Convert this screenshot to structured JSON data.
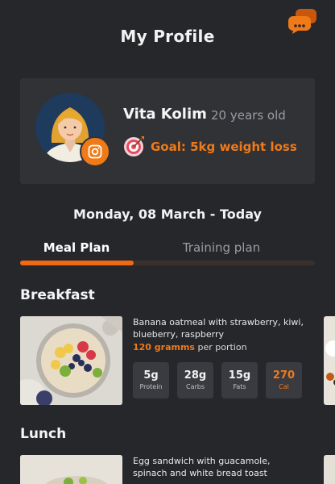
{
  "header": {
    "title": "My Profile"
  },
  "profile": {
    "name": "Vita Kolim",
    "age": "20 years old",
    "goal": "Goal: 5kg weight loss"
  },
  "date_line": "Monday, 08 March - Today",
  "tabs": {
    "meal_plan": "Meal Plan",
    "training_plan": "Training plan",
    "progress_fraction": 0.385
  },
  "meals": [
    {
      "section": "Breakfast",
      "description": "Banana oatmeal with strawberry, kiwi, blueberry, raspberry",
      "portion_qty": "120 gramms",
      "portion_suffix": " per portion",
      "nutrients": [
        {
          "value": "5g",
          "label": "Protein"
        },
        {
          "value": "28g",
          "label": "Carbs"
        },
        {
          "value": "15g",
          "label": "Fats"
        },
        {
          "value": "270",
          "label": "Cal"
        }
      ]
    },
    {
      "section": "Lunch",
      "description": "Egg sandwich with guacamole, spinach and white bread toast"
    }
  ],
  "colors": {
    "accent": "#f07a18",
    "background": "#26272b",
    "card": "#313236"
  },
  "icons": {
    "chat": "chat-bubbles-icon",
    "instagram": "instagram-icon",
    "goal": "target-icon"
  }
}
